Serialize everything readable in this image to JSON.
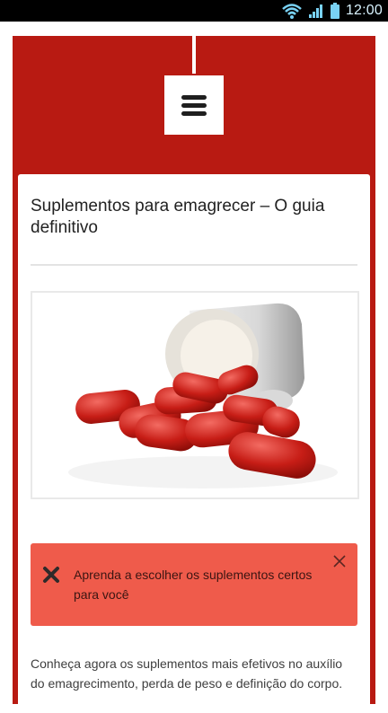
{
  "statusbar": {
    "time": "12:00",
    "icons": [
      "wifi-icon",
      "signal-icon",
      "battery-icon"
    ]
  },
  "header": {
    "menu_icon": "hamburger-menu-icon"
  },
  "article": {
    "title": "Suplementos para emagrecer – O guia definitivo",
    "image_icon": "red-capsules-image"
  },
  "alert": {
    "message": "Aprenda a escolher os suplementos certos para você",
    "close_icon": "close-icon",
    "icon": "x-mark-icon"
  },
  "intro": {
    "line1": "Conheça agora os suplementos mais efetivos no auxílio",
    "line2": "do emagrecimento, perda de peso e definição do corpo."
  },
  "colors": {
    "frame": "#b81a12",
    "alert": "#ef5b4b"
  }
}
